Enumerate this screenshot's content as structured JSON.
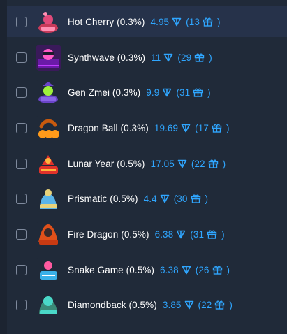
{
  "items": [
    {
      "name": "Hot Cherry (0.3%)",
      "price": "4.95",
      "count": "(13",
      "close": ")",
      "colors": {
        "bg": "#1f2a3a",
        "main": "#e04a7a",
        "accent": "#ff8fb3"
      }
    },
    {
      "name": "Synthwave (0.3%)",
      "price": "11",
      "count": "(29",
      "close": ")",
      "colors": {
        "bg": "#3a1a5a",
        "main": "#c03cff",
        "accent": "#ff5ac8"
      }
    },
    {
      "name": "Gen Zmei (0.3%)",
      "price": "9.9",
      "count": "(31",
      "close": ")",
      "colors": {
        "bg": "#1f2a3a",
        "main": "#6a44c8",
        "accent": "#9ef03c"
      }
    },
    {
      "name": "Dragon Ball (0.3%)",
      "price": "19.69",
      "count": "(17",
      "close": ")",
      "colors": {
        "bg": "#1f2a3a",
        "main": "#ff9a1a",
        "accent": "#c85a0e"
      }
    },
    {
      "name": "Lunar Year (0.5%)",
      "price": "17.05",
      "count": "(22",
      "close": ")",
      "colors": {
        "bg": "#1f2a3a",
        "main": "#e0322a",
        "accent": "#ffb43c"
      }
    },
    {
      "name": "Prismatic (0.5%)",
      "price": "4.4",
      "count": "(30",
      "close": ")",
      "colors": {
        "bg": "#1f2a3a",
        "main": "#5ab4e8",
        "accent": "#e8d27a"
      }
    },
    {
      "name": "Fire Dragon (0.5%)",
      "price": "6.38",
      "count": "(31",
      "close": ")",
      "colors": {
        "bg": "#1f2a3a",
        "main": "#e0501a",
        "accent": "#3a2a2a"
      }
    },
    {
      "name": "Snake Game (0.5%)",
      "price": "6.38",
      "count": "(26",
      "close": ")",
      "colors": {
        "bg": "#1f2a3a",
        "main": "#3ab0e8",
        "accent": "#ff5aa0"
      }
    },
    {
      "name": "Diamondback (0.5%)",
      "price": "3.85",
      "count": "(22",
      "close": ")",
      "colors": {
        "bg": "#1f2a3a",
        "main": "#4ad8c8",
        "accent": "#3a8a78"
      }
    }
  ],
  "theme": {
    "accent": "#2fa6ff",
    "text": "#ffffff",
    "panel": "#202a39"
  },
  "icons": {
    "currency": "ton-diamond-icon",
    "gift": "gift-icon"
  }
}
